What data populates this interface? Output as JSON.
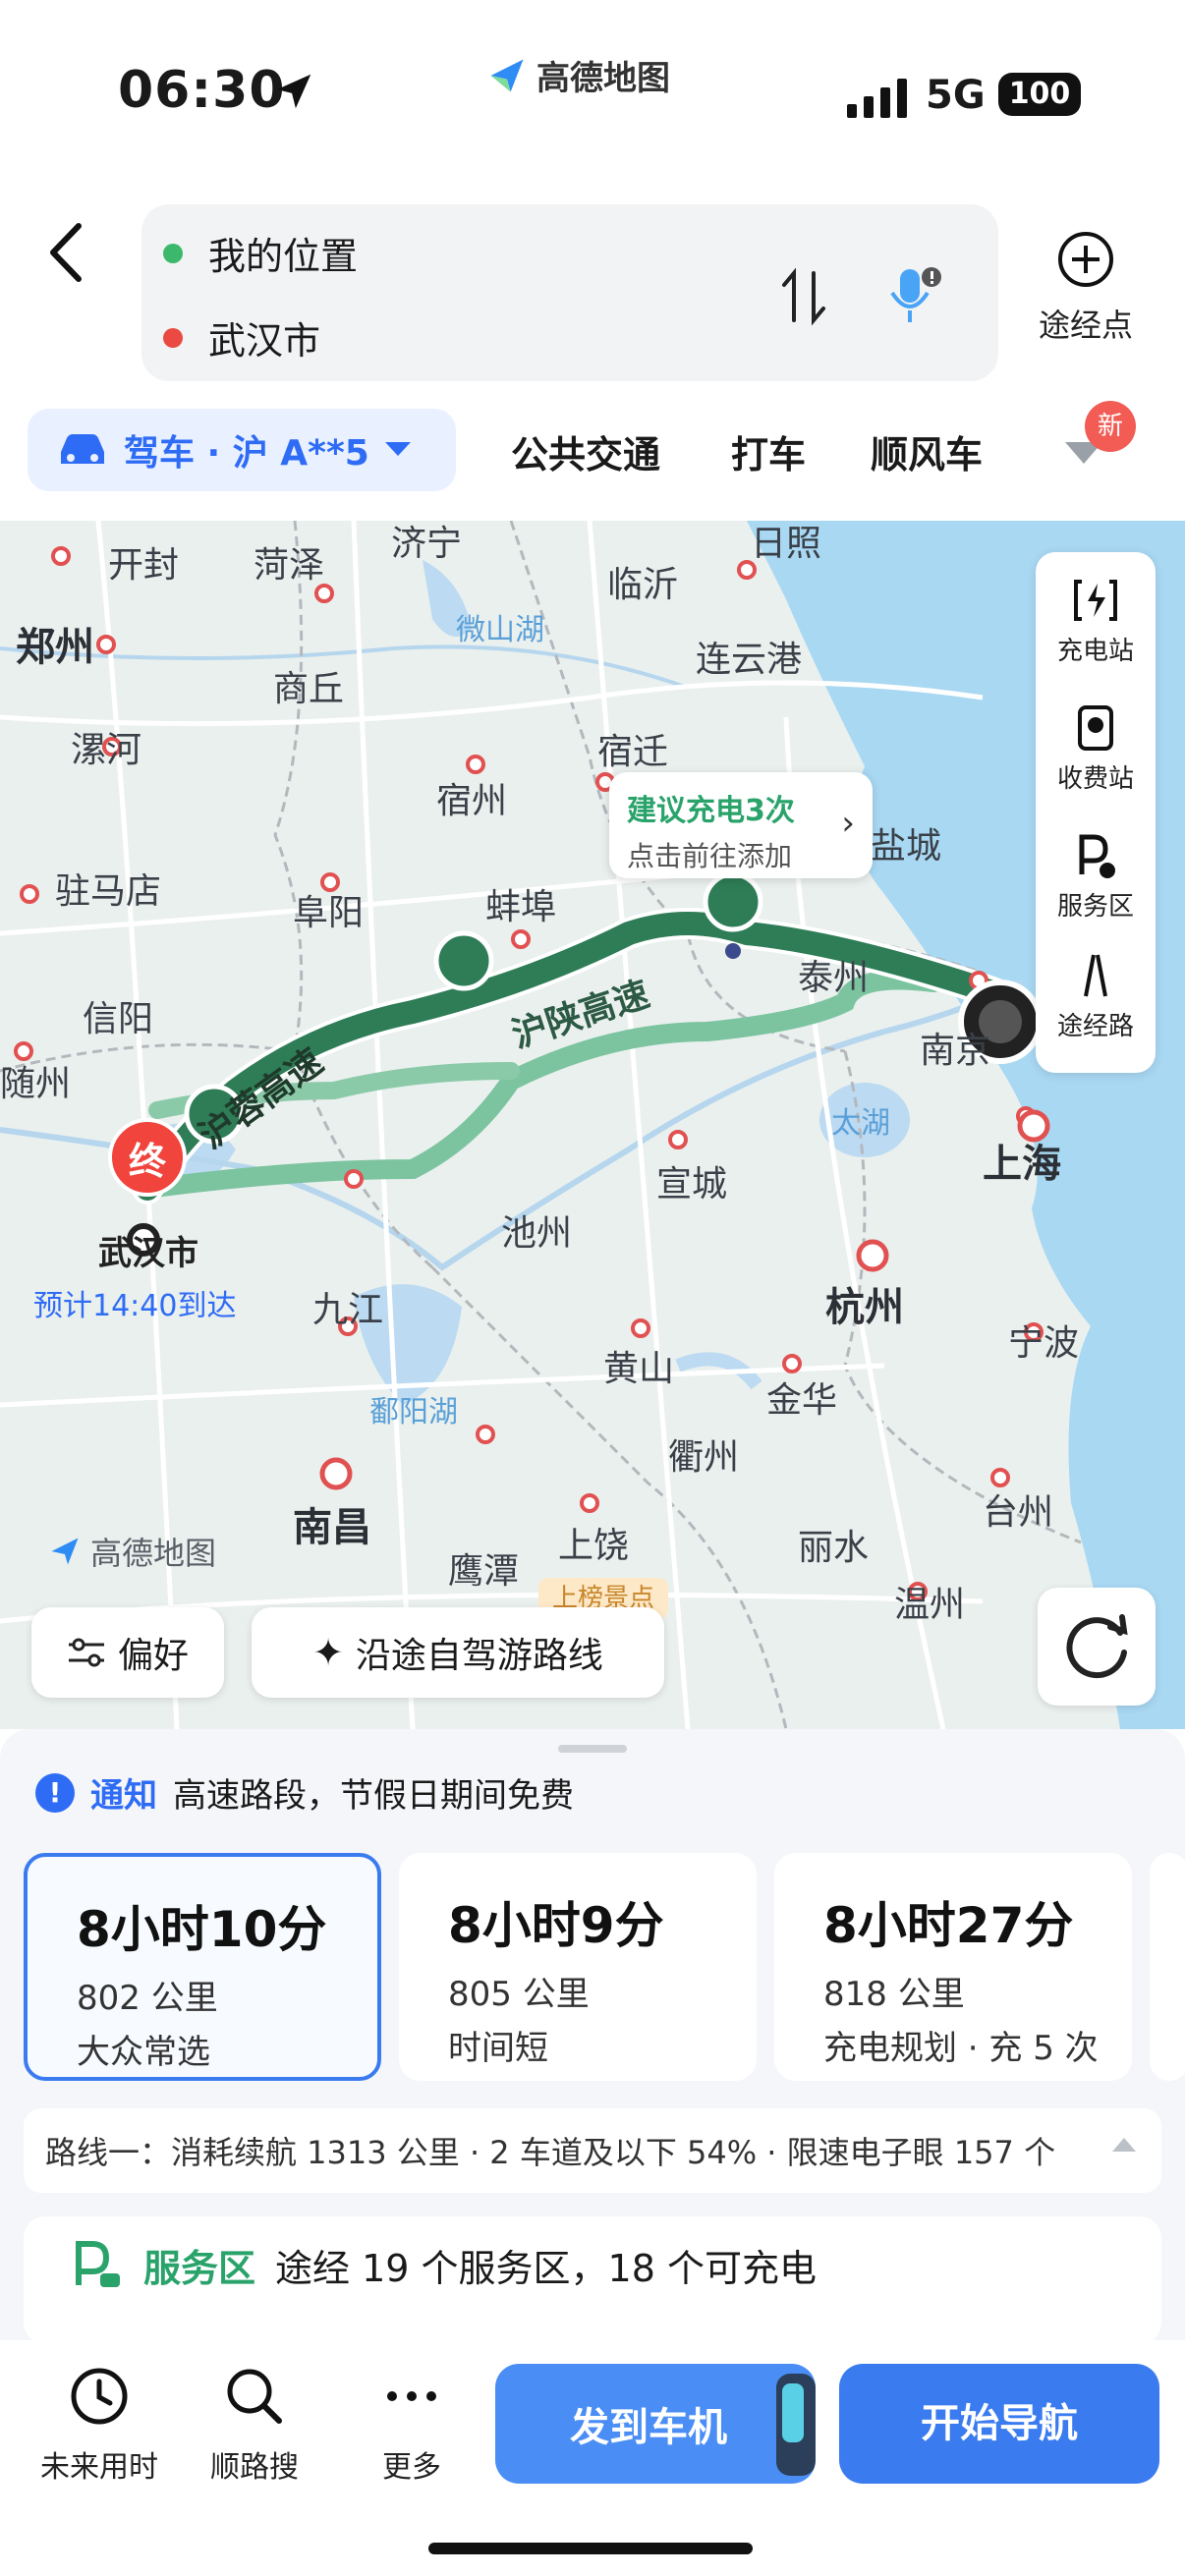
{
  "status_bar": {
    "time": "06:30",
    "network": "5G",
    "battery": "100"
  },
  "app": {
    "name": "高德地图"
  },
  "search": {
    "origin": "我的位置",
    "destination": "武汉市"
  },
  "waypoint": {
    "label": "途经点"
  },
  "modes": {
    "drive": "驾车 · 沪 A**5",
    "transit": "公共交通",
    "taxi": "打车",
    "carpool": "顺风车",
    "new_badge": "新"
  },
  "map": {
    "cities": [
      "济宁",
      "日照",
      "开封",
      "菏泽",
      "临沂",
      "郑州",
      "商丘",
      "连云港",
      "漯河",
      "宿迁",
      "宿州",
      "驻马店",
      "阜阳",
      "蚌埠",
      "信阳",
      "泰州",
      "随州",
      "南京",
      "上海",
      "宣城",
      "池州",
      "武汉市",
      "九江",
      "杭州",
      "宁波",
      "黄山",
      "金华",
      "鄱阳湖",
      "衢州",
      "南昌",
      "鹰潭",
      "上饶",
      "台州",
      "丽水",
      "温州",
      "盐城"
    ],
    "waters": [
      "微山湖",
      "太湖"
    ],
    "highways": [
      "沪蓉高速",
      "沪陕高速"
    ],
    "charge_tip_title": "建议充电3次",
    "charge_tip_sub": "点击前往添加",
    "end_marker": "终",
    "destination": "武汉市",
    "eta": "预计14:40到达",
    "watermark": "高德地图",
    "preference": "偏好",
    "self_drive": "沿途自驾游路线",
    "self_drive_tag": "上榜景点"
  },
  "toolbar": {
    "charge": "充电站",
    "toll": "收费站",
    "service": "服务区",
    "route": "途经路"
  },
  "notice": {
    "tag": "通知",
    "text": "高速路段，节假日期间免费"
  },
  "routes": [
    {
      "time": "8小时10分",
      "distance": "802 公里",
      "tag": "大众常选"
    },
    {
      "time": "8小时9分",
      "distance": "805 公里",
      "tag": "时间短"
    },
    {
      "time": "8小时27分",
      "distance": "818 公里",
      "tag": "充电规划 · 充 5 次"
    }
  ],
  "route_info": "路线一：消耗续航 1313 公里 · 2 车道及以下 54% · 限速电子眼 157 个",
  "service": {
    "title": "服务区",
    "text": "途经 19 个服务区，18 个可充电"
  },
  "bottom": {
    "future": "未来用时",
    "search_along": "顺路搜",
    "more": "更多",
    "send_car": "发到车机",
    "start_nav": "开始导航"
  },
  "colors": {
    "accent": "#3a7bf0",
    "route_primary": "#2e7d57",
    "route_secondary": "#7cc4a0",
    "end_marker": "#f0443c"
  }
}
